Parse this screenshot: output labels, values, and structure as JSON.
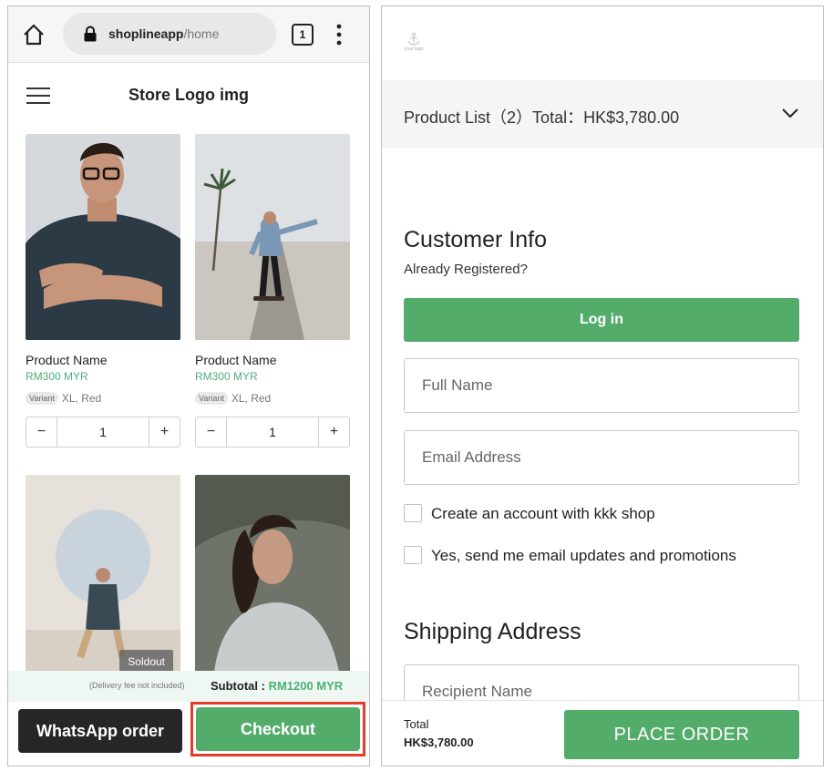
{
  "left_phone": {
    "browser": {
      "url_domain": "shoplineapp",
      "url_path": "/home",
      "tab_count": "1"
    },
    "store_title": "Store Logo img",
    "products": [
      {
        "name": "Product Name",
        "price": "RM300 MYR",
        "variant_tag": "Variant",
        "variant_value": "XL, Red",
        "quantity": "1",
        "minus": "−",
        "plus": "+"
      },
      {
        "name": "Product Name",
        "price": "RM300 MYR",
        "variant_tag": "Variant",
        "variant_value": "XL, Red",
        "quantity": "1",
        "minus": "−",
        "plus": "+"
      },
      {
        "soldout": "Soldout"
      },
      {}
    ],
    "delivery_note": "(Delivery fee not included)",
    "subtotal_label": "Subtotal :",
    "subtotal_value": "RM1200 MYR",
    "whatsapp_label": "WhatsApp order",
    "checkout_label": "Checkout",
    "accent_color": "#54ac6b",
    "highlight_color": "#e53d2a"
  },
  "right_phone": {
    "logo_text": "your logo",
    "product_summary": "Product List（2）Total：HK$3,780.00",
    "customer_info": {
      "title": "Customer Info",
      "registered_text": "Already Registered?",
      "login_label": "Log in",
      "full_name_placeholder": "Full Name",
      "email_placeholder": "Email Address",
      "create_account_label": "Create an account with kkk shop",
      "email_updates_label": "Yes, send me email updates and promotions"
    },
    "shipping": {
      "title": "Shipping Address",
      "recipient_placeholder": "Recipient Name"
    },
    "total_label": "Total",
    "total_value": "HK$3,780.00",
    "place_order_label": "PLACE ORDER"
  }
}
